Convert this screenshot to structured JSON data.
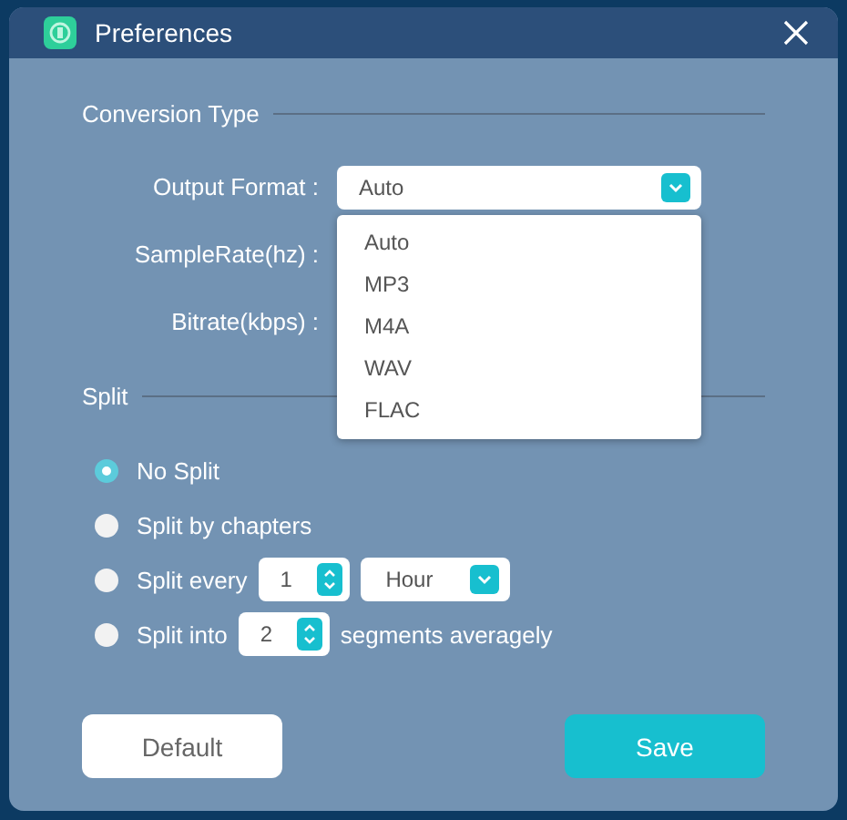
{
  "window": {
    "title": "Preferences"
  },
  "conversion": {
    "heading": "Conversion Type",
    "fields": [
      {
        "label": "Output Format :",
        "value": "Auto"
      },
      {
        "label": "SampleRate(hz) :"
      },
      {
        "label": "Bitrate(kbps) :"
      }
    ],
    "menu": [
      {
        "label": "Auto",
        "selected": false
      },
      {
        "label": "MP3",
        "selected": false
      },
      {
        "label": "M4A",
        "selected": false
      },
      {
        "label": "WAV",
        "selected": false
      },
      {
        "label": "FLAC",
        "selected": false
      }
    ]
  },
  "split": {
    "heading": "Split",
    "options": [
      {
        "kind": "plain",
        "label": "No Split",
        "selected": true
      },
      {
        "kind": "plain",
        "label": "Split by chapters",
        "selected": false
      },
      {
        "kind": "every",
        "label": "Split every",
        "count": "1",
        "unit": "Hour",
        "selected": false
      },
      {
        "kind": "into",
        "label": "Split into",
        "count": "2",
        "suffix": "segments averagely",
        "selected": false
      }
    ]
  },
  "buttons": [
    {
      "kind": "secondary",
      "label": "Default"
    },
    {
      "kind": "primary",
      "label": "Save"
    }
  ]
}
